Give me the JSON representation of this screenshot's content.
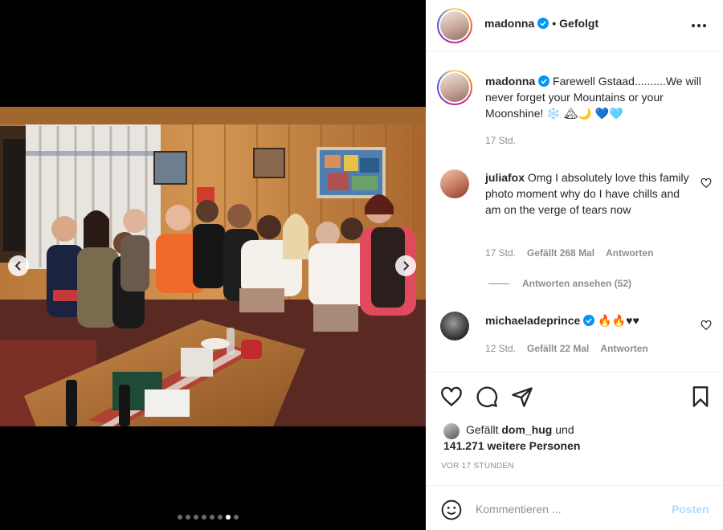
{
  "post": {
    "author": "madonna",
    "follow_status": "Gefolgt",
    "caption_text": "Farewell Gstaad..........We will never forget your Mountains or your Moonshine! ❄️ 🏔🌙 💙🩵",
    "caption_time": "17 Std.",
    "carousel": {
      "total": 8,
      "active_index": 6
    }
  },
  "comments": [
    {
      "user": "juliafox",
      "verified": false,
      "text": "Omg I absolutely love this family photo moment why do I have chills and am on the verge of tears now",
      "time": "17 Std.",
      "likes_label": "Gefällt 268 Mal",
      "reply_label": "Antworten",
      "view_replies_label": "Antworten ansehen (52)"
    },
    {
      "user": "michaeladeprince",
      "verified": true,
      "text": "🔥🔥♥♥",
      "time": "12 Std.",
      "likes_label": "Gefällt 22 Mal",
      "reply_label": "Antworten"
    }
  ],
  "likes": {
    "prefix": "Gefällt",
    "liker": "dom_hug",
    "connector": "und",
    "others": "141.271 weitere Personen"
  },
  "posted_ago": "VOR 17 STUNDEN",
  "composer": {
    "placeholder": "Kommentieren ...",
    "post_label": "Posten"
  },
  "icons": {
    "like": "heart-icon",
    "comment": "comment-icon",
    "share": "send-icon",
    "save": "bookmark-icon",
    "emoji": "smiley-icon",
    "more": "more-options-icon",
    "verified": "verified-badge-icon"
  },
  "colors": {
    "verified_blue": "#0095f6",
    "post_button_disabled": "#b3dbff",
    "meta_gray": "#8e8e8e",
    "text": "#262626"
  }
}
